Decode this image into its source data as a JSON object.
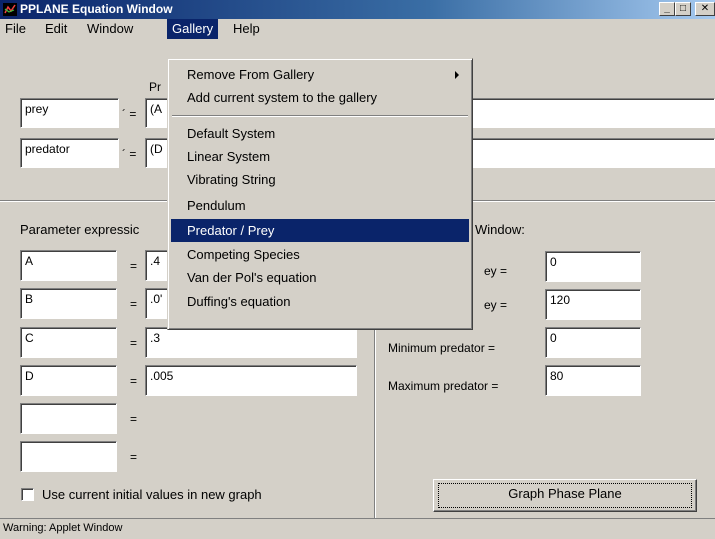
{
  "window": {
    "title": "PPLANE Equation Window",
    "controls": {
      "minimize": "_",
      "maximize": "□",
      "close": "✕"
    }
  },
  "menubar": {
    "items": [
      "File",
      "Edit",
      "Window",
      "Gallery",
      "Help"
    ],
    "active": "Gallery"
  },
  "equations": {
    "header_fragment": "Pr",
    "rows": [
      {
        "variable": "prey",
        "prime": "´ =",
        "expression": "(A"
      },
      {
        "variable": "predator",
        "prime": "´ =",
        "expression": "(D"
      }
    ]
  },
  "parameters": {
    "header": "Parameter expressic",
    "rows": [
      {
        "name": "A",
        "eq": "=",
        "value": ".4"
      },
      {
        "name": "B",
        "eq": "=",
        "value": ".0'"
      },
      {
        "name": "C",
        "eq": "=",
        "value": ".3"
      },
      {
        "name": "D",
        "eq": "=",
        "value": ".005"
      },
      {
        "name": "",
        "eq": "=",
        "value": null
      },
      {
        "name": "",
        "eq": "=",
        "value": null
      }
    ]
  },
  "display_window": {
    "header": "Window:",
    "rows": [
      {
        "label": "ey =",
        "value": "0"
      },
      {
        "label": "ey =",
        "value": "120"
      },
      {
        "label": "Minimum predator =",
        "value": "0"
      },
      {
        "label": "Maximum predator =",
        "value": "80"
      }
    ]
  },
  "checkbox": {
    "label": "Use current initial values in new graph",
    "checked": false
  },
  "graph_button": "Graph Phase Plane",
  "status": "Warning: Applet Window",
  "gallery_menu": {
    "items": [
      {
        "label": "Remove From Gallery",
        "submenu": true
      },
      {
        "label": "Add current system to the gallery"
      },
      {
        "label": "Default System"
      },
      {
        "label": "Linear System"
      },
      {
        "label": "Vibrating String"
      },
      {
        "label": "Pendulum"
      },
      {
        "label": "Predator / Prey",
        "highlighted": true
      },
      {
        "label": "Competing Species"
      },
      {
        "label": "Van der Pol's equation"
      },
      {
        "label": "Duffing's equation"
      }
    ]
  },
  "colors": {
    "face": "#d4d0c8",
    "titlebar": "#0a246a",
    "highlight": "#0a246a",
    "field": "#ffffff"
  }
}
